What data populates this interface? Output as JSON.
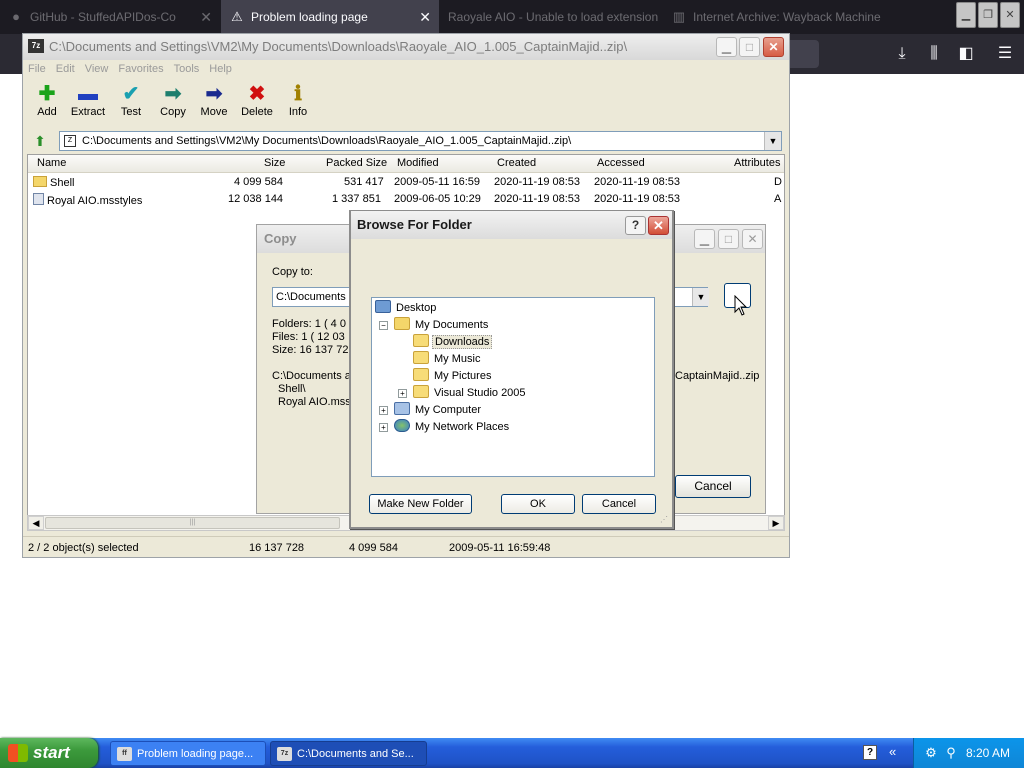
{
  "firefox": {
    "tabs": [
      {
        "label": "GitHub - StuffedAPIDos-Co",
        "icon": "github-icon",
        "active": false
      },
      {
        "label": "Problem loading page",
        "icon": "warning-icon",
        "active": true
      },
      {
        "label": "Raoyale AIO - Unable to load extension",
        "icon": "blank-icon",
        "active": false
      },
      {
        "label": "Internet Archive: Wayback Machine",
        "icon": "archive-icon",
        "active": false
      }
    ]
  },
  "zip": {
    "title": "C:\\Documents and Settings\\VM2\\My Documents\\Downloads\\Raoyale_AIO_1.005_CaptainMajid..zip\\",
    "app_badge": "7z",
    "menu": [
      "File",
      "Edit",
      "View",
      "Favorites",
      "Tools",
      "Help"
    ],
    "toolbar": [
      {
        "label": "Add",
        "icon": "add-icon",
        "glyph": "✚",
        "color": "#1aa31a"
      },
      {
        "label": "Extract",
        "icon": "extract-icon",
        "glyph": "▬",
        "color": "#2040c0"
      },
      {
        "label": "Test",
        "icon": "test-icon",
        "glyph": "✔",
        "color": "#1aa0b0"
      },
      {
        "label": "Copy",
        "icon": "copy-icon",
        "glyph": "➡",
        "color": "#1d7f6e"
      },
      {
        "label": "Move",
        "icon": "move-icon",
        "glyph": "➡",
        "color": "#1a2a8f"
      },
      {
        "label": "Delete",
        "icon": "delete-icon",
        "glyph": "✖",
        "color": "#d01010"
      },
      {
        "label": "Info",
        "icon": "info-icon",
        "glyph": "ℹ",
        "color": "#a08000"
      }
    ],
    "address": "C:\\Documents and Settings\\VM2\\My Documents\\Downloads\\Raoyale_AIO_1.005_CaptainMajid..zip\\",
    "columns": [
      "Name",
      "Size",
      "Packed Size",
      "Modified",
      "Created",
      "Accessed",
      "Attributes"
    ],
    "rows": [
      {
        "name": "Shell",
        "type": "folder",
        "size": "4 099 584",
        "packed": "531 417",
        "modified": "2009-05-11 16:59",
        "created": "2020-11-19 08:53",
        "accessed": "2020-11-19 08:53",
        "attr": "D"
      },
      {
        "name": "Royal AIO.msstyles",
        "type": "file",
        "size": "12 038 144",
        "packed": "1 337 851",
        "modified": "2009-06-05 10:29",
        "created": "2020-11-19 08:53",
        "accessed": "2020-11-19 08:53",
        "attr": "A"
      }
    ],
    "status": {
      "selected": "2 / 2 object(s) selected",
      "size": "16 137 728",
      "packed": "4 099 584",
      "modified": "2009-05-11 16:59:48"
    }
  },
  "copy_dialog": {
    "title": "Copy",
    "copy_to_label": "Copy to:",
    "path_value": "C:\\Documents a",
    "folders": "Folders: 1    ( 4 0",
    "files": "Files: 1    ( 12 03",
    "size": "Size: 16 137 728",
    "src_line": "C:\\Documents a",
    "src_tail": "CaptainMajid..zip",
    "item1": "Shell\\",
    "item2": "Royal AIO.mss",
    "cancel": "Cancel"
  },
  "browse_dialog": {
    "title": "Browse For Folder",
    "help": "?",
    "tree": [
      {
        "label": "Desktop",
        "icon": "desktop-icon",
        "level": 0,
        "expander": ""
      },
      {
        "label": "My Documents",
        "icon": "my-documents-icon",
        "level": 1,
        "expander": "−"
      },
      {
        "label": "Downloads",
        "icon": "folder-icon",
        "level": 2,
        "expander": "",
        "selected": true
      },
      {
        "label": "My Music",
        "icon": "folder-icon",
        "level": 2,
        "expander": ""
      },
      {
        "label": "My Pictures",
        "icon": "folder-icon",
        "level": 2,
        "expander": ""
      },
      {
        "label": "Visual Studio 2005",
        "icon": "folder-icon",
        "level": 2,
        "expander": "+"
      },
      {
        "label": "My Computer",
        "icon": "computer-icon",
        "level": 1,
        "expander": "+"
      },
      {
        "label": "My Network Places",
        "icon": "network-icon",
        "level": 1,
        "expander": "+"
      }
    ],
    "make_new_folder": "Make New Folder",
    "ok": "OK",
    "cancel": "Cancel"
  },
  "taskbar": {
    "start": "start",
    "tasks": [
      {
        "label": "Problem loading page...",
        "icon": "firefox-icon",
        "active": false
      },
      {
        "label": "C:\\Documents and Se...",
        "icon": "7zip-icon",
        "active": true
      }
    ],
    "clock": "8:20 AM"
  }
}
